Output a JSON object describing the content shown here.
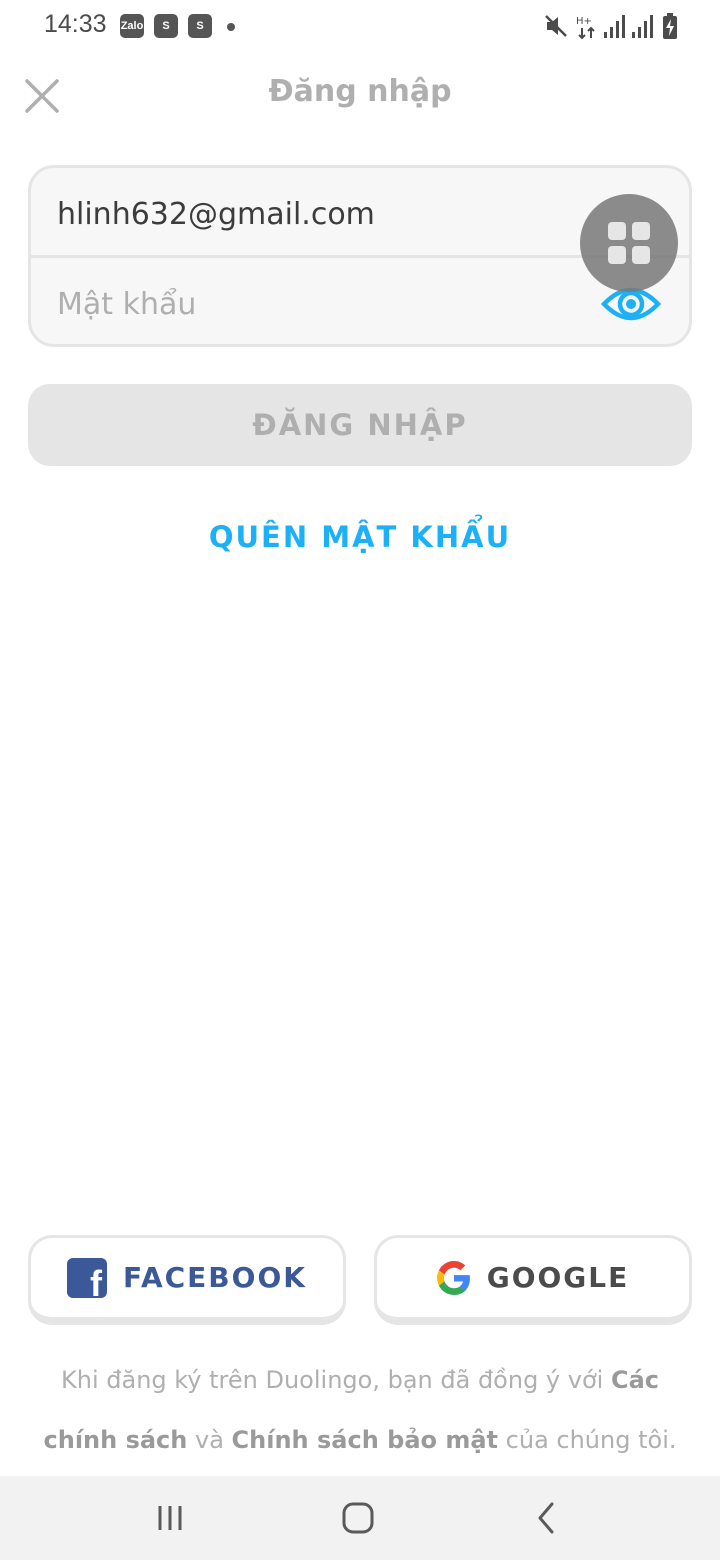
{
  "status_bar": {
    "time": "14:33",
    "notifications": [
      {
        "name": "zalo-icon",
        "label": "Zalo"
      },
      {
        "name": "shopee-icon",
        "label": "S"
      },
      {
        "name": "shopee-icon",
        "label": "S"
      }
    ],
    "system_icons": [
      "mute-icon",
      "data-transfer-icon",
      "signal-icon",
      "signal-icon",
      "battery-charging-icon"
    ]
  },
  "header": {
    "title": "Đăng nhập",
    "close_icon": "close-icon"
  },
  "form": {
    "email_value": "hlinh632@gmail.com",
    "password_placeholder": "Mật khẩu",
    "password_value": "",
    "eye_icon": "eye-icon"
  },
  "floating_button_icon": "grid-icon",
  "login_button_label": "ĐĂNG NHẬP",
  "forgot_password_label": "QUÊN MẬT KHẨU",
  "social": {
    "facebook_label": "FACEBOOK",
    "google_label": "GOOGLE"
  },
  "terms": {
    "prefix": "Khi đăng ký trên Duolingo, bạn đã đồng ý với ",
    "link1": "Các chính sách",
    "middle": " và ",
    "link2": "Chính sách bảo mật",
    "suffix": " của chúng tôi."
  },
  "nav_bar": {
    "recents_icon": "recents-icon",
    "home_icon": "home-icon",
    "back_icon": "back-icon"
  },
  "colors": {
    "accent": "#1cb0f6",
    "facebook": "#3b5998",
    "disabled_text": "#afafaf",
    "disabled_bg": "#e5e5e5"
  }
}
